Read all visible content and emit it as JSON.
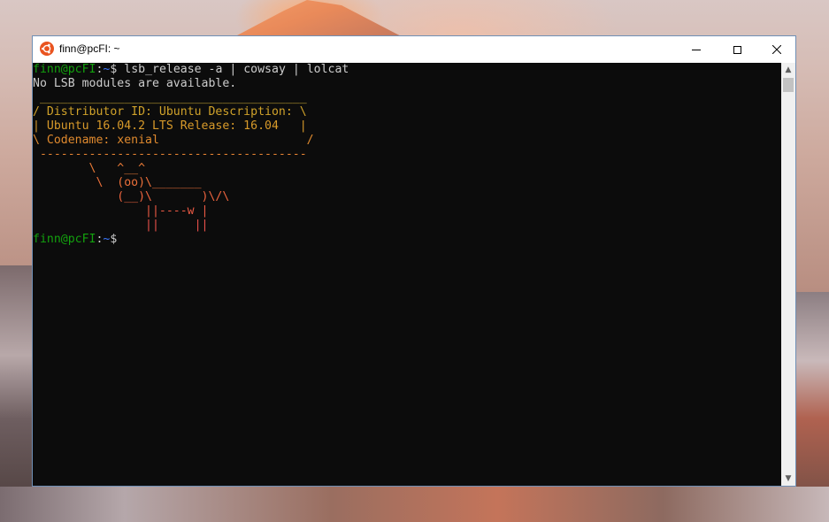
{
  "window": {
    "title": "finn@pcFI: ~",
    "app_icon": "ubuntu-icon",
    "minimize_icon": "minimize-icon",
    "maximize_icon": "maximize-icon",
    "close_icon": "close-icon"
  },
  "terminal": {
    "prompt_user_host": "finn@pcFI",
    "prompt_sep": ":",
    "prompt_path": "~",
    "prompt_symbol": "$",
    "command": " lsb_release -a | cowsay | lolcat",
    "output_plain": "No LSB modules are available.",
    "cowsay_lines": [
      {
        "text": " ______________________________________",
        "color": "#c8a832"
      },
      {
        "text": "/ Distributor ID: Ubuntu Description: \\",
        "color": "#d0a22a"
      },
      {
        "text": "| Ubuntu 16.04.2 LTS Release: 16.04   |",
        "color": "#d89a2a"
      },
      {
        "text": "\\ Codename: xenial                     /",
        "color": "#e08a2e"
      },
      {
        "text": " --------------------------------------",
        "color": "#e48232"
      },
      {
        "text": "        \\   ^__^",
        "color": "#e87a36"
      },
      {
        "text": "         \\  (oo)\\_______",
        "color": "#ec703a"
      },
      {
        "text": "            (__)\\       )\\/\\",
        "color": "#ee643e"
      },
      {
        "text": "                ||----w |",
        "color": "#ec5a44"
      },
      {
        "text": "                ||     ||",
        "color": "#e8504a"
      }
    ],
    "colors": {
      "prompt_user": "#13a10e",
      "prompt_path": "#3b78ff",
      "text": "#cccccc",
      "background": "#0c0c0c"
    }
  },
  "scrollbar": {
    "up_icon": "scroll-up-arrow-icon",
    "down_icon": "scroll-down-arrow-icon",
    "up_glyph": "▲",
    "down_glyph": "▼"
  }
}
